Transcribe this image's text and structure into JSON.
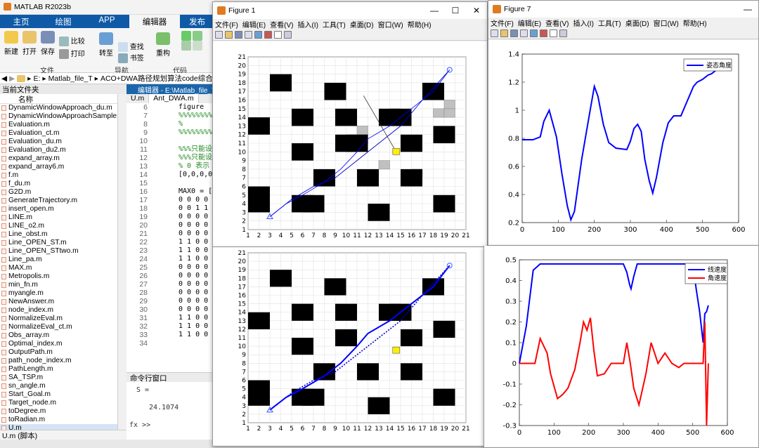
{
  "matlab": {
    "title": "MATLAB R2023b",
    "tabs": [
      "主页",
      "绘图",
      "APP",
      "编辑器",
      "发布"
    ],
    "ribbon": {
      "buttons": [
        "新建",
        "打开",
        "保存",
        "比较",
        "打印",
        "查找",
        "书签",
        "转至",
        "重构",
        "代码"
      ],
      "groups": [
        "文件",
        "导航",
        "代码"
      ]
    },
    "address": [
      "E:",
      "Matlab_file_T",
      "ACO+DWA路径规划算法code综合"
    ],
    "current_folder": "当前文件夹",
    "name_header": "名称",
    "files": [
      "DynamicWindowApproach_du.m",
      "DynamicWindowApproachSample.",
      "Evaluation.m",
      "Evaluation_ct.m",
      "Evaluation_du.m",
      "Evaluation_du2.m",
      "expand_array.m",
      "expand_array6.m",
      "f.m",
      "f_du.m",
      "G2D.m",
      "GenerateTrajectory.m",
      "insert_open.m",
      "LINE.m",
      "LINE_o2.m",
      "Line_obst.m",
      "Line_OPEN_ST.m",
      "Line_OPEN_STtwo.m",
      "Line_pa.m",
      "MAX.m",
      "Metropolis.m",
      "min_fn.m",
      "myangle.m",
      "NewAnswer.m",
      "node_index.m",
      "NormalizeEval.m",
      "NormalizeEval_ct.m",
      "Obs_array.m",
      "Optimal_index.m",
      "OutputPath.m",
      "path_node_index.m",
      "PathLength.m",
      "SA_TSP.m",
      "sn_angle.m",
      "Start_Goal.m",
      "Target_node.m",
      "toDegree.m",
      "toRadian.m",
      "U.m"
    ],
    "status": "U.m (脚本)",
    "editor": {
      "title": "编辑器 - E:\\Matlab_file_T\\A",
      "tabs": [
        "U.m",
        "Ant_DWA.m"
      ],
      "lines": [
        {
          "n": "6",
          "code": "figure",
          "cmt": false
        },
        {
          "n": "7",
          "code": "%%%%%%%%%",
          "cmt": true
        },
        {
          "n": "8",
          "code": "%",
          "cmt": true
        },
        {
          "n": "9",
          "code": "%%%%%%%%%",
          "cmt": true
        },
        {
          "n": "10",
          "code": "",
          "cmt": false
        },
        {
          "n": "11",
          "code": "%%%只能设",
          "cmt": true
        },
        {
          "n": "12",
          "code": "%%%只能设",
          "cmt": true
        },
        {
          "n": "13",
          "code": "%  0 表示",
          "cmt": true
        },
        {
          "n": "14",
          "code": "[0,0,0,0,",
          "cmt": false
        },
        {
          "n": "15",
          "code": "",
          "cmt": false
        },
        {
          "n": "16",
          "code": "MAX0 =  [",
          "cmt": false
        },
        {
          "n": "17",
          "code": "0 0 0 0 0",
          "cmt": false
        },
        {
          "n": "18",
          "code": "0 0 1 1 0",
          "cmt": false
        },
        {
          "n": "19",
          "code": "0 0 0 0 0",
          "cmt": false
        },
        {
          "n": "20",
          "code": "0 0 0 0 0",
          "cmt": false
        },
        {
          "n": "21",
          "code": "0 0 0 0 0",
          "cmt": false
        },
        {
          "n": "22",
          "code": "1 1 0 0 1",
          "cmt": false
        },
        {
          "n": "23",
          "code": "1 1 0 0 0",
          "cmt": false
        },
        {
          "n": "24",
          "code": "1 1 0 0 0",
          "cmt": false
        },
        {
          "n": "25",
          "code": "0 0 0 0 0",
          "cmt": false
        },
        {
          "n": "26",
          "code": "0 0 0 0 0",
          "cmt": false
        },
        {
          "n": "27",
          "code": "0 0 0 0 1",
          "cmt": false
        },
        {
          "n": "28",
          "code": "0 0 0 0 1",
          "cmt": false
        },
        {
          "n": "29",
          "code": "0 0 0 0 0",
          "cmt": false
        },
        {
          "n": "30",
          "code": "0 0 0 0 0",
          "cmt": false
        },
        {
          "n": "31",
          "code": "1 1 0 0 0",
          "cmt": false
        },
        {
          "n": "32",
          "code": "1 1 0 0 0",
          "cmt": false
        },
        {
          "n": "33",
          "code": "1 1 0 0 0",
          "cmt": false
        },
        {
          "n": "34",
          "code": "",
          "cmt": false
        }
      ]
    },
    "command_window": {
      "title": "命令行窗口",
      "line1": "S =",
      "line2": "24.1074",
      "prompt": "fx >>"
    }
  },
  "figure1": {
    "title": "Figure 1",
    "menu": [
      "文件(F)",
      "编辑(E)",
      "查看(V)",
      "插入(I)",
      "工具(T)",
      "桌面(D)",
      "窗口(W)",
      "帮助(H)"
    ]
  },
  "figure7": {
    "title": "Figure 7",
    "menu": [
      "文件(F)",
      "编辑(E)",
      "查看(V)",
      "插入(I)",
      "工具(T)",
      "桌面(D)",
      "窗口(W)",
      "帮助(H)"
    ]
  },
  "window_controls": {
    "minimize": "—",
    "maximize": "☐",
    "close": "✕"
  },
  "chart_data": [
    {
      "type": "line",
      "legend": [
        "姿态角度"
      ],
      "legend_position": "top-right",
      "xlim": [
        0,
        600
      ],
      "ylim": [
        0.2,
        1.4
      ],
      "xticks": [
        0,
        100,
        200,
        300,
        400,
        500,
        600
      ],
      "yticks": [
        0.2,
        0.4,
        0.6,
        0.8,
        1,
        1.2,
        1.4
      ],
      "series": [
        {
          "name": "姿态角度",
          "color": "#0000ff",
          "x": [
            0,
            30,
            50,
            60,
            75,
            95,
            110,
            125,
            135,
            145,
            165,
            185,
            200,
            210,
            225,
            240,
            260,
            290,
            300,
            310,
            320,
            330,
            340,
            352,
            362,
            372,
            390,
            405,
            420,
            440,
            460,
            475,
            485,
            500,
            515,
            525,
            535,
            545
          ],
          "y": [
            0.79,
            0.79,
            0.81,
            0.92,
            1.0,
            0.81,
            0.55,
            0.32,
            0.22,
            0.28,
            0.65,
            0.95,
            1.17,
            1.1,
            0.9,
            0.77,
            0.73,
            0.72,
            0.78,
            0.87,
            0.9,
            0.85,
            0.65,
            0.5,
            0.41,
            0.52,
            0.77,
            0.91,
            0.96,
            0.96,
            1.08,
            1.17,
            1.2,
            1.22,
            1.25,
            1.26,
            1.28,
            1.3
          ]
        }
      ]
    },
    {
      "type": "line",
      "legend": [
        "线速度",
        "角速度"
      ],
      "legend_position": "top-right",
      "xlim": [
        0,
        600
      ],
      "ylim": [
        -0.3,
        0.5
      ],
      "xticks": [
        0,
        100,
        200,
        300,
        400,
        500,
        600
      ],
      "yticks": [
        -0.3,
        -0.2,
        -0.1,
        0,
        0.1,
        0.2,
        0.3,
        0.4,
        0.5
      ],
      "series": [
        {
          "name": "线速度",
          "color": "#0000ff",
          "x": [
            0,
            20,
            40,
            60,
            300,
            310,
            318,
            322,
            330,
            340,
            350,
            500,
            510,
            520,
            530,
            535,
            540,
            545
          ],
          "y": [
            0.0,
            0.18,
            0.45,
            0.48,
            0.48,
            0.44,
            0.38,
            0.36,
            0.42,
            0.48,
            0.48,
            0.48,
            0.36,
            0.25,
            0.1,
            0.24,
            0.25,
            0.28
          ]
        },
        {
          "name": "角速度",
          "color": "#ff0000",
          "x": [
            0,
            45,
            60,
            80,
            90,
            110,
            125,
            140,
            160,
            175,
            185,
            195,
            205,
            215,
            225,
            245,
            265,
            300,
            310,
            320,
            330,
            345,
            365,
            380,
            400,
            420,
            440,
            460,
            475,
            490,
            510,
            520,
            530,
            535,
            540,
            545
          ],
          "y": [
            0.0,
            0.0,
            0.12,
            0.05,
            -0.05,
            -0.17,
            -0.15,
            -0.12,
            -0.03,
            0.1,
            0.2,
            0.16,
            0.22,
            0.06,
            -0.06,
            -0.05,
            0.0,
            0.0,
            0.1,
            0.0,
            -0.12,
            -0.2,
            -0.05,
            0.1,
            0.0,
            0.05,
            0.0,
            -0.02,
            0.0,
            0.0,
            0.0,
            0.0,
            0.0,
            0.2,
            -0.3,
            0.0
          ]
        }
      ]
    },
    {
      "type": "scatter",
      "xlim": [
        1,
        21
      ],
      "ylim": [
        1,
        21
      ],
      "xticks": [
        1,
        2,
        3,
        4,
        5,
        6,
        7,
        8,
        9,
        10,
        11,
        12,
        13,
        14,
        15,
        16,
        17,
        18,
        19,
        20,
        21
      ],
      "yticks": [
        1,
        2,
        3,
        4,
        5,
        6,
        7,
        8,
        9,
        10,
        11,
        12,
        13,
        14,
        15,
        16,
        17,
        18,
        19,
        20,
        21
      ],
      "obstacles_black": [
        [
          3,
          18
        ],
        [
          8,
          17
        ],
        [
          17,
          17
        ],
        [
          1,
          13
        ],
        [
          5,
          14
        ],
        [
          9,
          14
        ],
        [
          13,
          14
        ],
        [
          14,
          14
        ],
        [
          15,
          11
        ],
        [
          18,
          12
        ],
        [
          9,
          11
        ],
        [
          10,
          11
        ],
        [
          5,
          10
        ],
        [
          7,
          7
        ],
        [
          11,
          7
        ],
        [
          15,
          7
        ],
        [
          1,
          4
        ],
        [
          1,
          5
        ],
        [
          5,
          4
        ],
        [
          6,
          4
        ],
        [
          12,
          3
        ],
        [
          18,
          4
        ]
      ],
      "obstacles_gray": [
        [
          11,
          12
        ],
        [
          11,
          11
        ],
        [
          18,
          14
        ],
        [
          19,
          14
        ],
        [
          19,
          15
        ],
        [
          13,
          8
        ],
        [
          16,
          7
        ]
      ],
      "start": [
        3,
        2.5
      ],
      "goal": [
        19.5,
        19.5
      ],
      "aco_path": {
        "x": [
          3,
          5,
          7,
          9,
          11,
          13,
          15,
          17,
          19.5
        ],
        "y": [
          2.5,
          4.5,
          6,
          7,
          9,
          11,
          13,
          16,
          19.5
        ]
      },
      "dwa_path": {
        "x": [
          3,
          4.5,
          6,
          8,
          9.5,
          11,
          12,
          14,
          16,
          18,
          19.5
        ],
        "y": [
          2.5,
          4,
          5,
          6.5,
          8,
          10,
          11.5,
          13,
          15,
          17,
          19.5
        ]
      },
      "dashed_line": {
        "x": [
          11.6,
          14.6
        ],
        "y": [
          16.5,
          10
        ]
      },
      "marker_yellow": [
        14.6,
        10
      ]
    },
    {
      "type": "scatter",
      "xlim": [
        1,
        21
      ],
      "ylim": [
        1,
        21
      ],
      "xticks": [
        1,
        2,
        3,
        4,
        5,
        6,
        7,
        8,
        9,
        10,
        11,
        12,
        13,
        14,
        15,
        16,
        17,
        18,
        19,
        20,
        21
      ],
      "yticks": [
        1,
        2,
        3,
        4,
        5,
        6,
        7,
        8,
        9,
        10,
        11,
        12,
        13,
        14,
        15,
        16,
        17,
        18,
        19,
        20,
        21
      ],
      "obstacles_black": [
        [
          3,
          18
        ],
        [
          8,
          17
        ],
        [
          17,
          17
        ],
        [
          1,
          13
        ],
        [
          5,
          14
        ],
        [
          9,
          14
        ],
        [
          13,
          14
        ],
        [
          14,
          14
        ],
        [
          15,
          11
        ],
        [
          18,
          12
        ],
        [
          9,
          11
        ],
        [
          5,
          10
        ],
        [
          7,
          7
        ],
        [
          11,
          7
        ],
        [
          15,
          7
        ],
        [
          1,
          4
        ],
        [
          1,
          5
        ],
        [
          5,
          4
        ],
        [
          6,
          4
        ],
        [
          12,
          3
        ],
        [
          18,
          4
        ]
      ],
      "start": [
        3,
        2.5
      ],
      "goal": [
        19.5,
        19.5
      ],
      "aco_path": {
        "x": [
          3,
          5,
          7,
          9,
          11,
          13,
          15,
          17,
          19.5
        ],
        "y": [
          2.5,
          4.5,
          6,
          7,
          9,
          11,
          13,
          16,
          19.5
        ]
      },
      "dwa_path": {
        "x": [
          3,
          4.5,
          6,
          8,
          9.5,
          11,
          12,
          14,
          16,
          18,
          19.5
        ],
        "y": [
          2.5,
          4,
          5,
          6.5,
          8,
          10,
          11.5,
          13,
          15,
          17,
          19.5
        ]
      },
      "marker_yellow": [
        14.6,
        9.5
      ]
    }
  ]
}
